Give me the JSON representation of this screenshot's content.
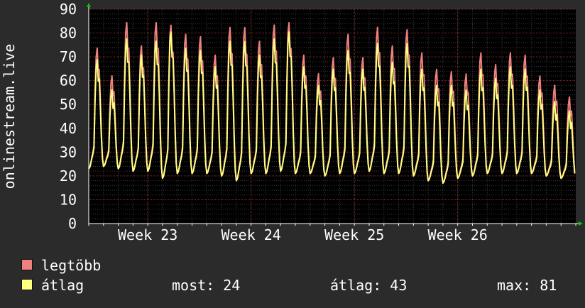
{
  "chart_data": {
    "type": "line",
    "ylabel": "onlinestream.live",
    "ylim": [
      0,
      90
    ],
    "yticks": [
      0,
      10,
      20,
      30,
      40,
      50,
      60,
      70,
      80,
      90
    ],
    "x_tick_labels": [
      "Week 23",
      "Week 24",
      "Week 25",
      "Week 26"
    ],
    "grid": true,
    "daily_peak_legtobb": [
      73,
      61,
      84,
      74,
      84,
      83,
      79,
      78,
      70,
      82,
      82,
      76,
      83,
      84,
      70,
      62,
      69,
      79,
      69,
      82,
      74,
      81,
      71,
      64,
      63,
      62,
      71,
      66,
      71,
      70,
      61,
      57,
      52
    ],
    "daily_peak_atlag": [
      68,
      55,
      77,
      70,
      76,
      80,
      73,
      72,
      65,
      76,
      76,
      70,
      77,
      80,
      65,
      57,
      64,
      72,
      64,
      75,
      67,
      75,
      64,
      57,
      57,
      55,
      64,
      60,
      65,
      64,
      55,
      50,
      46
    ],
    "daily_min": [
      23,
      24,
      23,
      22,
      22,
      19,
      21,
      21,
      21,
      20,
      18,
      21,
      21,
      22,
      21,
      21,
      20,
      21,
      21,
      22,
      21,
      21,
      20,
      18,
      17,
      19,
      20,
      21,
      21,
      21,
      21,
      20,
      19
    ],
    "series": [
      {
        "name": "legtöbb",
        "color": "#f08080"
      },
      {
        "name": "átlag",
        "color": "#ffff80"
      }
    ]
  },
  "legend": {
    "max_label": "legtöbb",
    "avg_label": "átlag",
    "max_color": "#f08080",
    "avg_color": "#ffff80"
  },
  "stats": {
    "now": "most: 24",
    "avg": "átlag: 43",
    "max": "max: 81"
  },
  "colors": {
    "background": "#2b2b2b",
    "plot_background": "#000000",
    "grid_major": "#8a2a2a",
    "grid_minor": "#3a3a3a",
    "axis": "#ffffff",
    "arrow": "#00cc00"
  }
}
